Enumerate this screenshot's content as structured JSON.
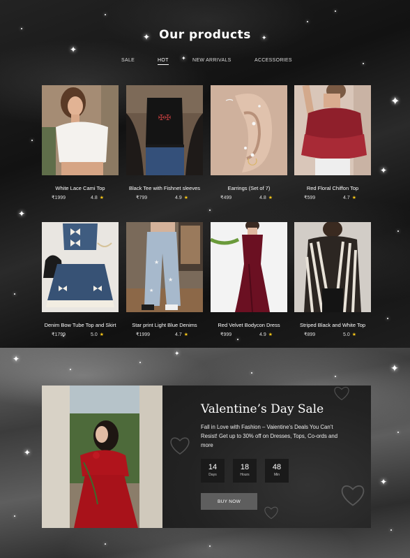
{
  "header": {
    "title": "Our products"
  },
  "nav": {
    "items": [
      {
        "label": "SALE",
        "active": false
      },
      {
        "label": "HOT",
        "active": true
      },
      {
        "label": "NEW ARRIVALS",
        "active": false
      },
      {
        "label": "ACCESSORIES",
        "active": false
      }
    ]
  },
  "products": [
    {
      "name": "White Lace Cami Top",
      "price": "₹1999",
      "rating": "4.8"
    },
    {
      "name": "Black Tee with Fishnet sleeves",
      "price": "₹799",
      "rating": "4.9"
    },
    {
      "name": "Earrings (Set of 7)",
      "price": "₹499",
      "rating": "4.8"
    },
    {
      "name": "Red Floral Chiffon Top",
      "price": "₹599",
      "rating": "4.7"
    },
    {
      "name": "Denim Bow Tube Top and Skirt",
      "price": "₹1799",
      "rating": "5.0"
    },
    {
      "name": "Star print Light Blue Denims",
      "price": "₹1999",
      "rating": "4.7"
    },
    {
      "name": "Red Velvet Bodycon Dress",
      "price": "₹999",
      "rating": "4.9"
    },
    {
      "name": "Striped Black and White Top",
      "price": "₹899",
      "rating": "5.0"
    }
  ],
  "sale": {
    "title": "Valentine’s Day Sale",
    "description": "Fall in Love with Fashion – Vaientine’s Deals You Can’t Resist! Get up to 30% off on Dresses, Tops, Co-ords and more",
    "countdown": [
      {
        "value": "14",
        "label": "Days"
      },
      {
        "value": "18",
        "label": "Hours"
      },
      {
        "value": "48",
        "label": "Min"
      }
    ],
    "button_label": "BUY NOW"
  },
  "colors": {
    "star": "#f5c518",
    "button": "#5e5e5e",
    "panel": "#262626"
  }
}
